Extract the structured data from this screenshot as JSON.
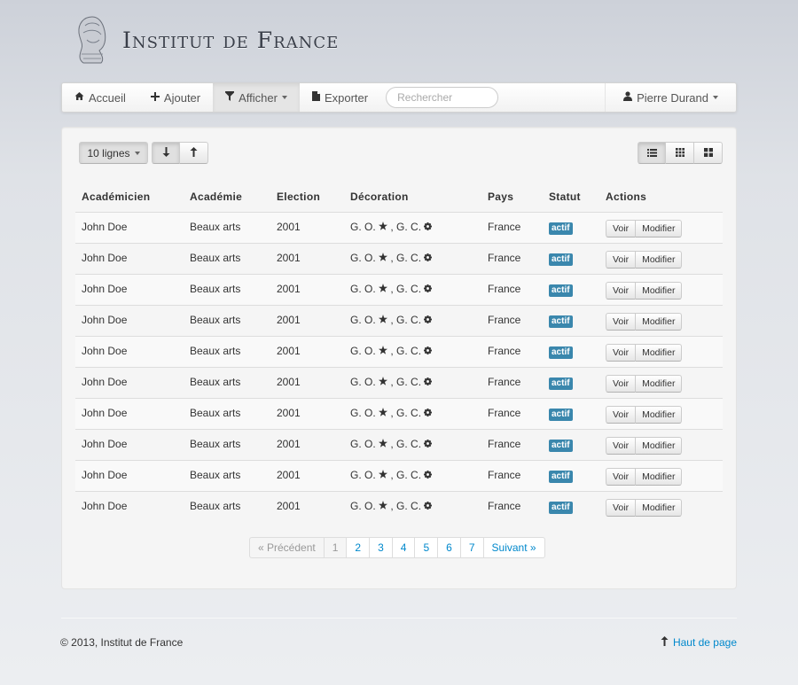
{
  "brand": {
    "title": "Institut de France"
  },
  "navbar": {
    "items": [
      {
        "label": "Accueil",
        "icon": "home-icon"
      },
      {
        "label": "Ajouter",
        "icon": "plus-icon"
      },
      {
        "label": "Afficher",
        "icon": "filter-icon"
      },
      {
        "label": "Exporter",
        "icon": "file-icon"
      }
    ],
    "search_placeholder": "Rechercher",
    "user": "Pierre Durand"
  },
  "toolbar": {
    "rows_label": "10 lignes"
  },
  "table": {
    "columns": [
      "Académicien",
      "Académie",
      "Election",
      "Décoration",
      "Pays",
      "Statut",
      "Actions"
    ],
    "rows": [
      {
        "name": "John Doe",
        "academie": "Beaux arts",
        "election": "2001",
        "deco_a": "G. O.",
        "deco_b": ", G. C.",
        "pays": "France",
        "statut": "actif"
      },
      {
        "name": "John Doe",
        "academie": "Beaux arts",
        "election": "2001",
        "deco_a": "G. O.",
        "deco_b": ", G. C.",
        "pays": "France",
        "statut": "actif"
      },
      {
        "name": "John Doe",
        "academie": "Beaux arts",
        "election": "2001",
        "deco_a": "G. O.",
        "deco_b": ", G. C.",
        "pays": "France",
        "statut": "actif"
      },
      {
        "name": "John Doe",
        "academie": "Beaux arts",
        "election": "2001",
        "deco_a": "G. O.",
        "deco_b": ", G. C.",
        "pays": "France",
        "statut": "actif"
      },
      {
        "name": "John Doe",
        "academie": "Beaux arts",
        "election": "2001",
        "deco_a": "G. O.",
        "deco_b": ", G. C.",
        "pays": "France",
        "statut": "actif"
      },
      {
        "name": "John Doe",
        "academie": "Beaux arts",
        "election": "2001",
        "deco_a": "G. O.",
        "deco_b": ", G. C.",
        "pays": "France",
        "statut": "actif"
      },
      {
        "name": "John Doe",
        "academie": "Beaux arts",
        "election": "2001",
        "deco_a": "G. O.",
        "deco_b": ", G. C.",
        "pays": "France",
        "statut": "actif"
      },
      {
        "name": "John Doe",
        "academie": "Beaux arts",
        "election": "2001",
        "deco_a": "G. O.",
        "deco_b": ", G. C.",
        "pays": "France",
        "statut": "actif"
      },
      {
        "name": "John Doe",
        "academie": "Beaux arts",
        "election": "2001",
        "deco_a": "G. O.",
        "deco_b": ", G. C.",
        "pays": "France",
        "statut": "actif"
      },
      {
        "name": "John Doe",
        "academie": "Beaux arts",
        "election": "2001",
        "deco_a": "G. O.",
        "deco_b": ", G. C.",
        "pays": "France",
        "statut": "actif"
      }
    ],
    "view_label": "Voir",
    "edit_label": "Modifier"
  },
  "pagination": {
    "prev": "« Précédent",
    "pages": [
      "1",
      "2",
      "3",
      "4",
      "5",
      "6",
      "7"
    ],
    "next": "Suivant »"
  },
  "footer": {
    "copyright": "© 2013, Institut de France",
    "top_link": "Haut de page"
  },
  "colors": {
    "accent": "#0088cc",
    "badge": "#3a87ad"
  }
}
